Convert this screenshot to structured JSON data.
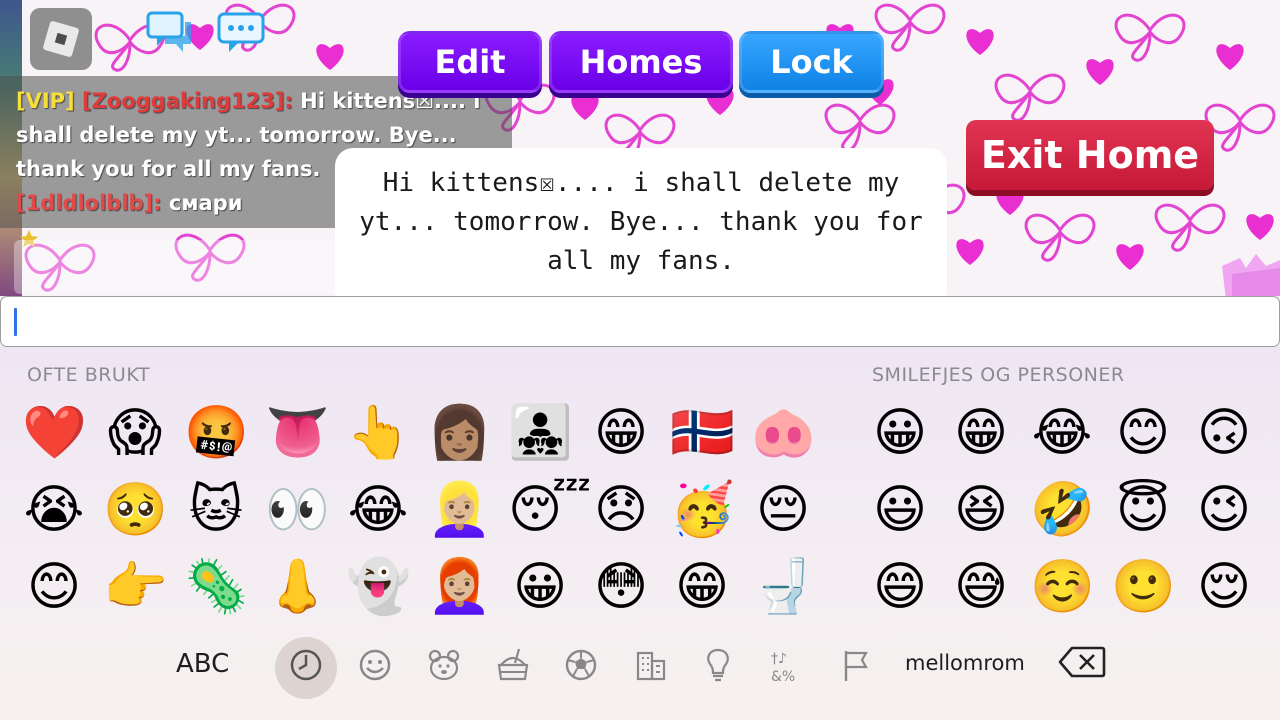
{
  "game": {
    "nav_buttons": {
      "edit": "Edit",
      "homes": "Homes",
      "lock": "Lock"
    },
    "exit_button": "Exit Home",
    "chat": {
      "line1_tag": "[VIP]",
      "line1_user": "[Zooggaking123]:",
      "line1_msg": " Hi kittens☒.... i shall delete my yt... tomorrow. Bye... thank you for all my fans.",
      "line2_user": "[1dldlolblb]:",
      "line2_msg": " смари"
    },
    "bubble": "Hi kittens☒.... i shall delete my yt... tomorrow.  Bye... thank you for all my fans.",
    "colors": {
      "vip": "#f7df3a",
      "username": "#e03b3b",
      "edit": "#7a10f5",
      "lock": "#1a8cf0",
      "exit": "#d1203f"
    }
  },
  "input": {
    "value": ""
  },
  "keyboard": {
    "section_frequent": "OFTE BRUKT",
    "section_smileys": "SMILEFJES OG PERSONER",
    "abc": "ABC",
    "space": "mellomrom",
    "frequent_rows": [
      [
        "❤️",
        "😱",
        "🤬",
        "👅",
        "👆",
        "👩🏽",
        "👨‍👧‍👧",
        "😁",
        "🇳🇴",
        "🐽"
      ],
      [
        "😭",
        "🥺",
        "🐱",
        "👀",
        "😂",
        "👱🏼‍♀️",
        "😴",
        "😞",
        "🥳",
        "😔"
      ],
      [
        "😊",
        "👉",
        "🦠",
        "👃",
        "👻",
        "👩🏼‍🦰",
        "😀",
        "😳",
        "😁",
        "🚽"
      ]
    ],
    "smiley_rows": [
      [
        "😀",
        "😁",
        "😂",
        "😊",
        "🙃"
      ],
      [
        "😃",
        "😆",
        "🤣",
        "😇",
        "😉"
      ],
      [
        "😄",
        "😅",
        "☺️",
        "🙂",
        "😌"
      ]
    ],
    "categories": [
      "recent-icon",
      "smiley-icon",
      "animal-icon",
      "food-icon",
      "ball-icon",
      "building-icon",
      "lightbulb-icon",
      "symbols-icon",
      "flag-icon"
    ]
  }
}
